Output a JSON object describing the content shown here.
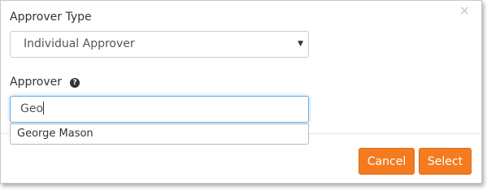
{
  "dialog": {
    "close_glyph": "×",
    "approver_type": {
      "label": "Approver Type",
      "selected": "Individual Approver",
      "caret": "▼"
    },
    "approver": {
      "label": "Approver",
      "help_glyph": "?",
      "input_value": "Geo",
      "suggestions": [
        "George Mason"
      ]
    },
    "footer": {
      "cancel_label": "Cancel",
      "select_label": "Select"
    }
  },
  "colors": {
    "accent": "#f47b20",
    "focus_border": "#66afe9"
  },
  "icons": {
    "close": "close-icon",
    "help": "help-circle-icon",
    "dropdown": "caret-down-icon"
  }
}
